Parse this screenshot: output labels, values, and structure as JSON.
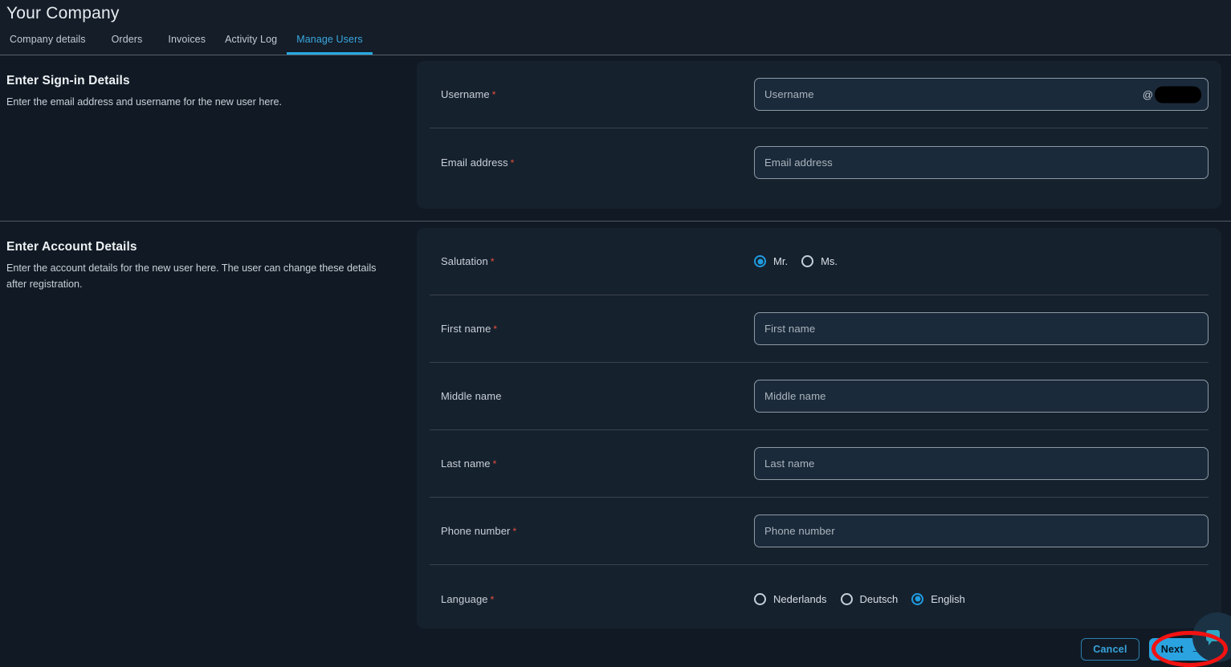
{
  "header": {
    "title": "Your Company",
    "tabs": [
      {
        "label": "Company details",
        "active": false
      },
      {
        "label": "Orders",
        "active": false
      },
      {
        "label": "Invoices",
        "active": false
      },
      {
        "label": "Activity Log",
        "active": false
      },
      {
        "label": "Manage Users",
        "active": true
      }
    ]
  },
  "signin_section": {
    "title": "Enter Sign-in Details",
    "description": "Enter the email address and username for the new user here.",
    "fields": {
      "username": {
        "label": "Username",
        "required_marker": "*",
        "placeholder": "Username",
        "value": "",
        "suffix_at": "@",
        "suffix_domain_redacted": true
      },
      "email": {
        "label": "Email address",
        "required_marker": "*",
        "placeholder": "Email address",
        "value": ""
      }
    }
  },
  "account_section": {
    "title": "Enter Account Details",
    "description": "Enter the account details for the new user here. The user can change these details after registration.",
    "fields": {
      "salutation": {
        "label": "Salutation",
        "required_marker": "*",
        "options": [
          {
            "label": "Mr.",
            "selected": true
          },
          {
            "label": "Ms.",
            "selected": false
          }
        ]
      },
      "first_name": {
        "label": "First name",
        "required_marker": "*",
        "placeholder": "First name",
        "value": ""
      },
      "middle_name": {
        "label": "Middle name",
        "required_marker": "",
        "placeholder": "Middle name",
        "value": ""
      },
      "last_name": {
        "label": "Last name",
        "required_marker": "*",
        "placeholder": "Last name",
        "value": ""
      },
      "phone_number": {
        "label": "Phone number",
        "required_marker": "*",
        "placeholder": "Phone number",
        "value": ""
      },
      "language": {
        "label": "Language",
        "required_marker": "*",
        "options": [
          {
            "label": "Nederlands",
            "selected": false
          },
          {
            "label": "Deutsch",
            "selected": false
          },
          {
            "label": "English",
            "selected": true
          }
        ]
      }
    }
  },
  "footer": {
    "cancel_label": "Cancel",
    "next_label": "Next",
    "next_arrow_icon": "arrow-right-icon"
  },
  "chat_widget": {
    "icon": "chat-bubble-icon"
  },
  "annotation": {
    "shape": "ellipse",
    "color": "#f21212",
    "target": "next-button"
  },
  "colors": {
    "page_background": "#111a24",
    "card_background": "#16212e",
    "input_background": "#1b2a3a",
    "accent": "#2aa3e0",
    "active_tab": "#3ba7e0",
    "required_asterisk": "#e8503a",
    "annotation_red": "#f21212"
  }
}
